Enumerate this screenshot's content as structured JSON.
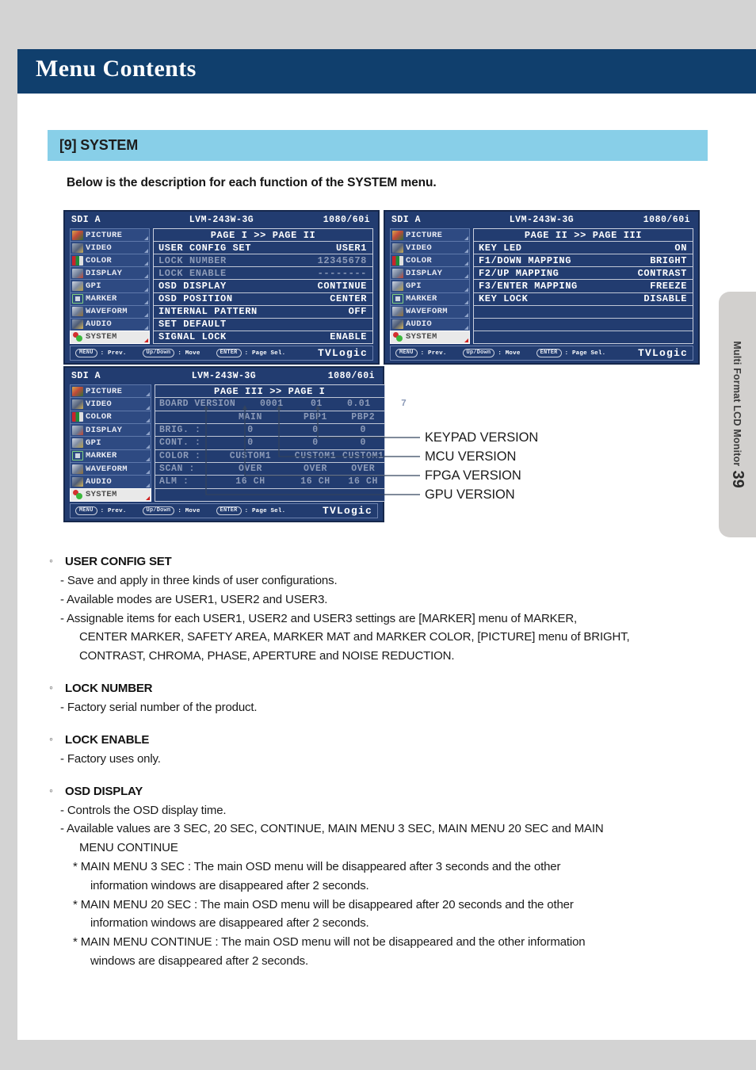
{
  "page": {
    "title": "Menu Contents",
    "section_heading": "[9] SYSTEM",
    "intro": "Below is the description for each function of the SYSTEM menu.",
    "side_tab_label": "Multi Format LCD Monitor",
    "page_number": "39"
  },
  "colors": {
    "title_bar": "#103f6d",
    "section_bar": "#88cfe8",
    "osd_background": "#223c70",
    "page_edge": "#d3d3d3"
  },
  "osd_menu_items": [
    {
      "label": "PICTURE",
      "icon": "palette-icon",
      "selected": false
    },
    {
      "label": "VIDEO",
      "icon": "camcorder-icon",
      "selected": false
    },
    {
      "label": "COLOR",
      "icon": "color-bars-icon",
      "selected": false
    },
    {
      "label": "DISPLAY",
      "icon": "monitor-icon",
      "selected": false
    },
    {
      "label": "GPI",
      "icon": "connector-icon",
      "selected": false
    },
    {
      "label": "MARKER",
      "icon": "marker-icon",
      "selected": false
    },
    {
      "label": "WAVEFORM",
      "icon": "waveform-icon",
      "selected": false
    },
    {
      "label": "AUDIO",
      "icon": "speaker-icon",
      "selected": false
    },
    {
      "label": "SYSTEM",
      "icon": "system-icon",
      "selected": true
    }
  ],
  "osd_footer": {
    "hints": [
      {
        "key": "MENU",
        "text": ": Prev."
      },
      {
        "key": "Up/Down",
        "text": ": Move"
      },
      {
        "key": "ENTER",
        "text": ": Page Sel."
      }
    ],
    "brand": "TVLogic"
  },
  "osd_panels": [
    {
      "name": "page-1",
      "status": {
        "source": "SDI A",
        "model": "LVM-243W-3G",
        "format": "1080/60i"
      },
      "page_title": "PAGE I >> PAGE II",
      "rows": [
        {
          "key": "USER CONFIG SET",
          "value": "USER1",
          "dim": false
        },
        {
          "key": "LOCK NUMBER",
          "value": "12345678",
          "dim": true
        },
        {
          "key": "LOCK ENABLE",
          "value": "--------",
          "dim": true
        },
        {
          "key": "OSD DISPLAY",
          "value": "CONTINUE",
          "dim": false
        },
        {
          "key": "OSD POSITION",
          "value": "CENTER",
          "dim": false
        },
        {
          "key": "INTERNAL PATTERN",
          "value": "OFF",
          "dim": false
        },
        {
          "key": "SET DEFAULT",
          "value": "",
          "dim": false
        },
        {
          "key": "SIGNAL LOCK",
          "value": "ENABLE",
          "dim": false
        }
      ]
    },
    {
      "name": "page-2",
      "status": {
        "source": "SDI A",
        "model": "LVM-243W-3G",
        "format": "1080/60i"
      },
      "page_title": "PAGE II >> PAGE III",
      "rows": [
        {
          "key": "KEY LED",
          "value": "ON",
          "dim": false
        },
        {
          "key": "F1/DOWN  MAPPING",
          "value": "BRIGHT",
          "dim": false
        },
        {
          "key": "F2/UP    MAPPING",
          "value": "CONTRAST",
          "dim": false
        },
        {
          "key": "F3/ENTER MAPPING",
          "value": "FREEZE",
          "dim": false
        },
        {
          "key": "KEY LOCK",
          "value": "DISABLE",
          "dim": false
        },
        {
          "key": "",
          "value": "",
          "dim": false
        },
        {
          "key": "",
          "value": "",
          "dim": false
        },
        {
          "key": "",
          "value": "",
          "dim": false
        }
      ]
    }
  ],
  "osd_panel3": {
    "name": "page-3",
    "status": {
      "source": "SDI A",
      "model": "LVM-243W-3G",
      "format": "1080/60i"
    },
    "page_title": "PAGE III >> PAGE I",
    "board_version": {
      "label": "BOARD VERSION",
      "keypad": "0001",
      "mcu": "01",
      "fpga": "0.01",
      "gpu": "7"
    },
    "columns": [
      "MAIN",
      "PBP1",
      "PBP2"
    ],
    "rows": [
      {
        "key": "BRIG.  :",
        "main": "0",
        "pbp1": "0",
        "pbp2": "0"
      },
      {
        "key": "CONT.  :",
        "main": "0",
        "pbp1": "0",
        "pbp2": "0"
      },
      {
        "key": "COLOR  :",
        "main": "CUSTOM1",
        "pbp1": "CUSTOM1",
        "pbp2": "CUSTOM1"
      },
      {
        "key": "SCAN   :",
        "main": "OVER",
        "pbp1": "OVER",
        "pbp2": "OVER"
      },
      {
        "key": "ALM    :",
        "main": "16 CH",
        "pbp1": "16 CH",
        "pbp2": "16 CH"
      }
    ]
  },
  "callouts": [
    {
      "label": "KEYPAD VERSION"
    },
    {
      "label": "MCU VERSION"
    },
    {
      "label": "FPGA VERSION"
    },
    {
      "label": "GPU VERSION"
    }
  ],
  "descriptions": [
    {
      "heading": "USER CONFIG SET",
      "lines": [
        {
          "indent": "i1",
          "text": "- Save and apply in three kinds of user configurations."
        },
        {
          "indent": "i1",
          "text": "- Available modes are USER1, USER2 and USER3."
        },
        {
          "indent": "i1",
          "text": "- Assignable items for each USER1, USER2 and USER3 settings are  [MARKER] menu of MARKER,"
        },
        {
          "indent": "i2",
          "text": "CENTER MARKER, SAFETY AREA, MARKER MAT and MARKER COLOR, [PICTURE] menu of BRIGHT,"
        },
        {
          "indent": "i2",
          "text": "CONTRAST,  CHROMA, PHASE, APERTURE and NOISE REDUCTION."
        }
      ]
    },
    {
      "heading": "LOCK NUMBER",
      "lines": [
        {
          "indent": "i1",
          "text": "- Factory serial number of the product."
        }
      ]
    },
    {
      "heading": "LOCK ENABLE",
      "lines": [
        {
          "indent": "i1",
          "text": "- Factory uses only."
        }
      ]
    },
    {
      "heading": "OSD DISPLAY",
      "lines": [
        {
          "indent": "i1",
          "text": "- Controls the OSD display time."
        },
        {
          "indent": "i1",
          "text": "- Available values are 3 SEC, 20 SEC, CONTINUE, MAIN MENU 3 SEC, MAIN MENU 20 SEC and MAIN"
        },
        {
          "indent": "i2",
          "text": "MENU CONTINUE"
        },
        {
          "indent": "i3",
          "text": "* MAIN MENU 3 SEC : The main OSD menu will be disappeared after 3 seconds and the other"
        },
        {
          "indent": "i4",
          "text": "information windows are disappeared after 2 seconds."
        },
        {
          "indent": "i3",
          "text": "* MAIN MENU 20 SEC : The main OSD menu will be disappeared after 20 seconds and the other"
        },
        {
          "indent": "i4",
          "text": "information windows are disappeared after 2 seconds."
        },
        {
          "indent": "i3",
          "text": "* MAIN MENU CONTINUE : The main OSD menu will not be disappeared and the other information"
        },
        {
          "indent": "i4",
          "text": "windows are disappeared after 2 seconds."
        }
      ]
    }
  ]
}
